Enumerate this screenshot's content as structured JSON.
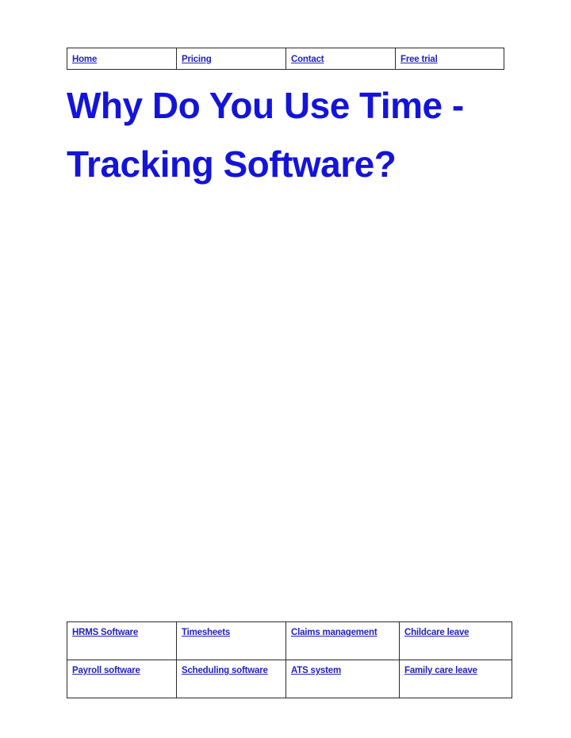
{
  "document": {
    "title": "Why Do You Use Time - Tracking Software?",
    "title_line_1": "Why Do You Use Time -",
    "title_line_2": "Tracking Software?",
    "title_color": "#1414d8",
    "link_color": "#2222bb",
    "background_color": "#ffffff",
    "border_color": "#2a2a2a"
  },
  "nav": {
    "items": [
      {
        "label": "Home"
      },
      {
        "label": "Pricing"
      },
      {
        "label": "Contact"
      },
      {
        "label": "Free trial"
      }
    ]
  },
  "body_region": {
    "content": ""
  },
  "footer": {
    "rows": [
      [
        {
          "label": "HRMS Software"
        },
        {
          "label": "Timesheets"
        },
        {
          "label": "Claims management"
        },
        {
          "label": "Childcare leave"
        }
      ],
      [
        {
          "label": "Payroll software"
        },
        {
          "label": "Scheduling  software"
        },
        {
          "label": "ATS system"
        },
        {
          "label": "Family care leave "
        }
      ]
    ]
  }
}
